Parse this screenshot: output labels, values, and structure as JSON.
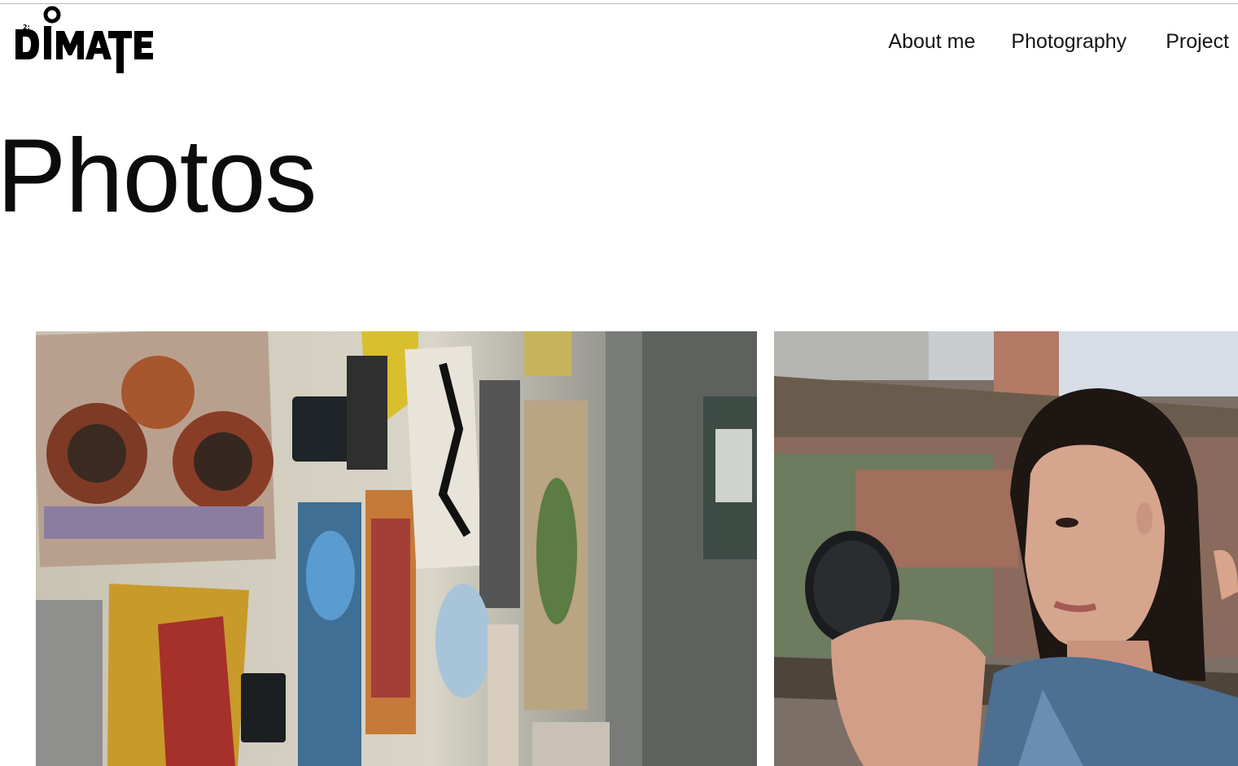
{
  "header": {
    "logo_alt": "DIMATE",
    "nav": {
      "about": "About me",
      "photography": "Photography",
      "project": "Project"
    }
  },
  "main": {
    "title": "Photos"
  },
  "gallery": {
    "photos": [
      {
        "subject": "wall-of-art-prints"
      },
      {
        "subject": "woman-with-compact-mirror"
      }
    ]
  }
}
